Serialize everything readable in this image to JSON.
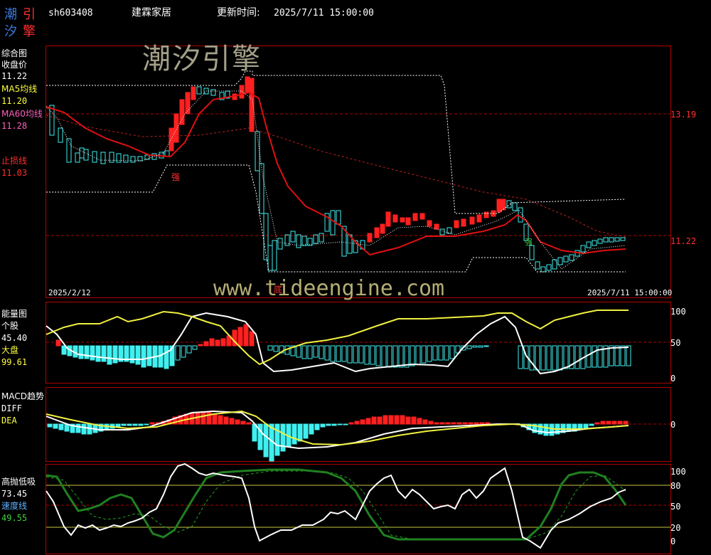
{
  "header": {
    "logo_chars": [
      "潮",
      "引",
      "汐",
      "擎"
    ],
    "stock_code": "sh603408",
    "stock_name": "建霖家居",
    "update_label": "更新时间:",
    "update_time": "2025/7/11 15:00:00"
  },
  "watermarks": {
    "brand": "潮汐引擎",
    "url": "www.tideengine.com"
  },
  "main_panel": {
    "title": "综合图",
    "close_label": "收盘价",
    "close_value": "11.22",
    "ma5_label": "MA5均线",
    "ma5_value": "11.20",
    "ma60_label": "MA60均线",
    "ma60_value": "11.28",
    "stop_label": "止损线",
    "stop_value": "11.03",
    "axis_upper": "13.19",
    "axis_lower": "11.22",
    "date_start": "2025/2/12",
    "date_end": "2025/7/11 15:00:00",
    "marker_strong": "强",
    "marker_bottom": "底",
    "marker_mid": "强"
  },
  "energy_panel": {
    "title": "能量图",
    "stock_label": "个股",
    "stock_value": "45.40",
    "market_label": "大盘",
    "market_value": "99.61",
    "axis_100": "100",
    "axis_50": "50",
    "axis_0": "0"
  },
  "macd_panel": {
    "title": "MACD趋势",
    "diff_label": "DIFF",
    "dea_label": "DEA",
    "axis_0": "0"
  },
  "hilo_panel": {
    "title": "高抛低吸",
    "value1": "73.45",
    "speed_label": "速度线",
    "speed_value": "49.55",
    "axis_100": "100",
    "axis_80": "80",
    "axis_50": "50",
    "axis_20": "20",
    "axis_0": "0"
  },
  "colors": {
    "up": "#ff2020",
    "down": "#40f0f0",
    "ma": "#e01010",
    "yellow": "#ffff40",
    "green": "#208020",
    "grid": "#b00000"
  }
}
